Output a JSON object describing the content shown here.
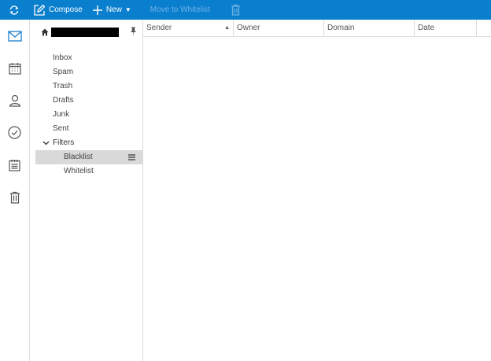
{
  "toolbar": {
    "refresh_icon": "refresh-icon",
    "compose_label": "Compose",
    "new_label": "New",
    "new_caret": "▼",
    "move_label": "Move to Whitelist",
    "trash_icon": "trash-icon",
    "bg_color": "#0a7fce",
    "disabled_color": "#6fb2e4"
  },
  "rail": {
    "items": [
      {
        "icon": "mail-icon"
      },
      {
        "icon": "calendar-icon"
      },
      {
        "icon": "contacts-icon"
      },
      {
        "icon": "tasks-icon"
      },
      {
        "icon": "notes-icon"
      },
      {
        "icon": "trash-icon"
      }
    ],
    "accent": "#1a7fcf"
  },
  "folders": {
    "home_icon": "home-icon",
    "pin_icon": "pin-icon",
    "items": [
      "Inbox",
      "Spam",
      "Trash",
      "Drafts",
      "Junk",
      "Sent"
    ],
    "filters_label": "Filters",
    "filters_sub": [
      "Blacklist",
      "Whitelist"
    ],
    "selected": "Blacklist",
    "selected_bg": "#d9d9d9"
  },
  "list": {
    "columns": [
      "Sender",
      "Owner",
      "Domain",
      "Date"
    ],
    "sort_indicator": "▲"
  }
}
